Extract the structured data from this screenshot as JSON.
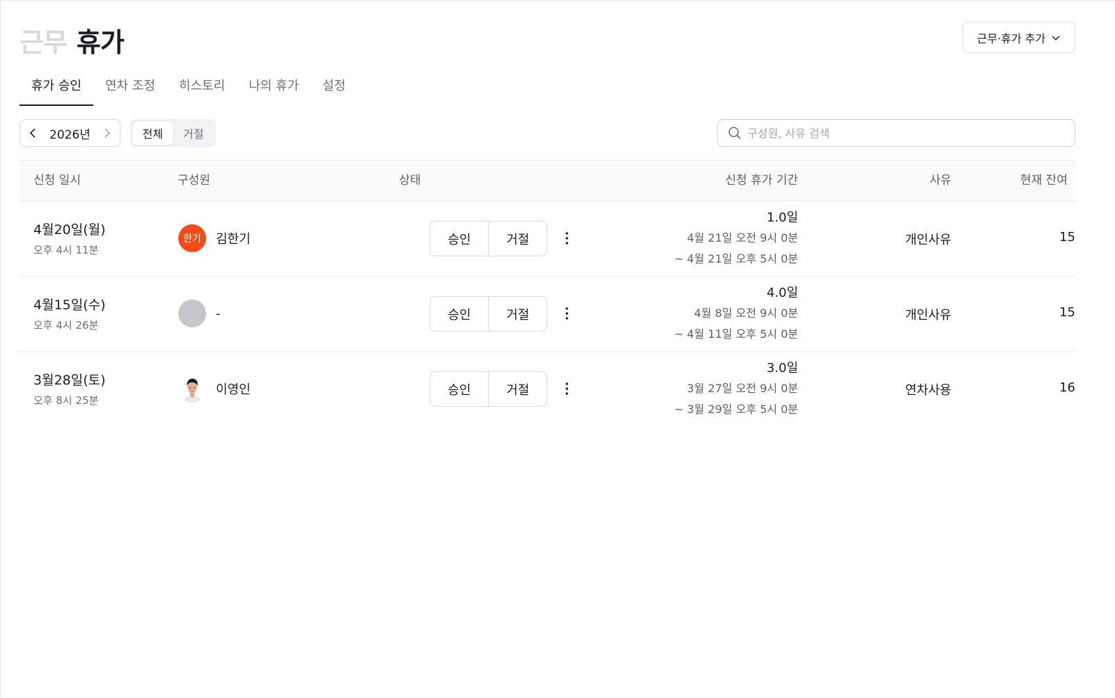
{
  "header": {
    "title_inactive": "근무",
    "title_active": "휴가",
    "add_button_label": "근무·휴가 추가"
  },
  "tabs": [
    {
      "label": "휴가 승인",
      "active": true
    },
    {
      "label": "연차 조정",
      "active": false
    },
    {
      "label": "히스토리",
      "active": false
    },
    {
      "label": "나의 휴가",
      "active": false
    },
    {
      "label": "설정",
      "active": false
    }
  ],
  "filters": {
    "year": "2026년",
    "segments": [
      {
        "label": "전체",
        "active": true
      },
      {
        "label": "거절",
        "active": false
      }
    ],
    "search_placeholder": "구성원, 사유 검색"
  },
  "table": {
    "columns": [
      "신청 일시",
      "구성원",
      "상태",
      "신청 휴가 기간",
      "사유",
      "현재 잔여"
    ],
    "action_labels": {
      "approve": "승인",
      "reject": "거절"
    },
    "rows": [
      {
        "date": "4월20일(월)",
        "time": "오후 4시 11분",
        "member": {
          "name": "김한기",
          "avatar_text": "한기",
          "avatar_type": "initials",
          "avatar_color": "#f04d1a"
        },
        "days": "1.0일",
        "range_start": "4월 21일 오전 9시 0분",
        "range_end": "~ 4월 21일 오후 5시 0분",
        "reason": "개인사유",
        "remaining": "15"
      },
      {
        "date": "4월15일(수)",
        "time": "오후 4시 26분",
        "member": {
          "name": "-",
          "avatar_text": "",
          "avatar_type": "empty",
          "avatar_color": "#c5c6cd"
        },
        "days": "4.0일",
        "range_start": "4월 8일 오전 9시 0분",
        "range_end": "~ 4월 11일 오후 5시 0분",
        "reason": "개인사유",
        "remaining": "15"
      },
      {
        "date": "3월28일(토)",
        "time": "오후 8시 25분",
        "member": {
          "name": "이영인",
          "avatar_text": "",
          "avatar_type": "photo",
          "avatar_color": "#ffffff"
        },
        "days": "3.0일",
        "range_start": "3월 27일 오전 9시 0분",
        "range_end": "~ 3월 29일 오후 5시 0분",
        "reason": "연차사용",
        "remaining": "16"
      }
    ]
  }
}
